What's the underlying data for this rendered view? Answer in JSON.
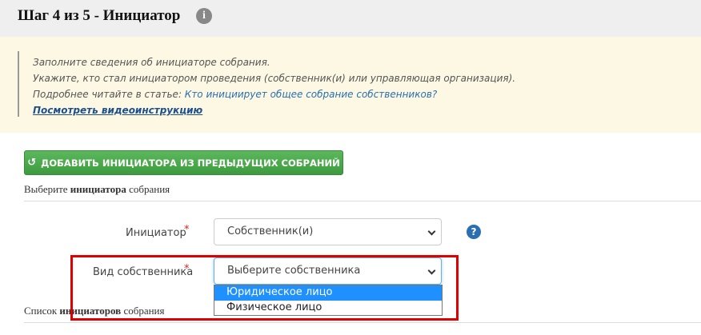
{
  "header": {
    "title": "Шаг 4 из 5 - Инициатор",
    "info_icon": "i"
  },
  "notice": {
    "line1": "Заполните сведения об инициаторе собрания.",
    "line2": "Укажите, кто стал инициатором проведения (собственник(и) или управляющая организация).",
    "line3_prefix": "Подробнее читайте в статье: ",
    "line3_link": "Кто инициирует общее собрание собственников?",
    "video_link": "Посмотреть видеоинструкцию"
  },
  "add_button": {
    "icon": "↺",
    "label": "ДОБАВИТЬ ИНИЦИАТОРА ИЗ ПРЕДЫДУЩИХ СОБРАНИЙ"
  },
  "choose_section": {
    "prefix": "Выберите ",
    "bold": "инициатора",
    "suffix": " собрания"
  },
  "initiator_field": {
    "label": "Инициатор",
    "required_mark": "*",
    "value": "Собственник(и)",
    "help_icon": "?"
  },
  "owner_type_field": {
    "label": "Вид собственника",
    "required_mark": "*",
    "value": "Выберите собственника",
    "options": [
      {
        "label": "Юридическое лицо",
        "selected": true
      },
      {
        "label": "Физическое лицо",
        "selected": false
      }
    ]
  },
  "list_section": {
    "prefix": "Список ",
    "bold": "инициаторов",
    "suffix": " собрания"
  },
  "colors": {
    "accent_green": "#5cb85c",
    "notice_bg": "#fcf8e3",
    "link_blue": "#2a6fb0",
    "highlight_red": "#e00000",
    "option_selected": "#1e90ff"
  }
}
